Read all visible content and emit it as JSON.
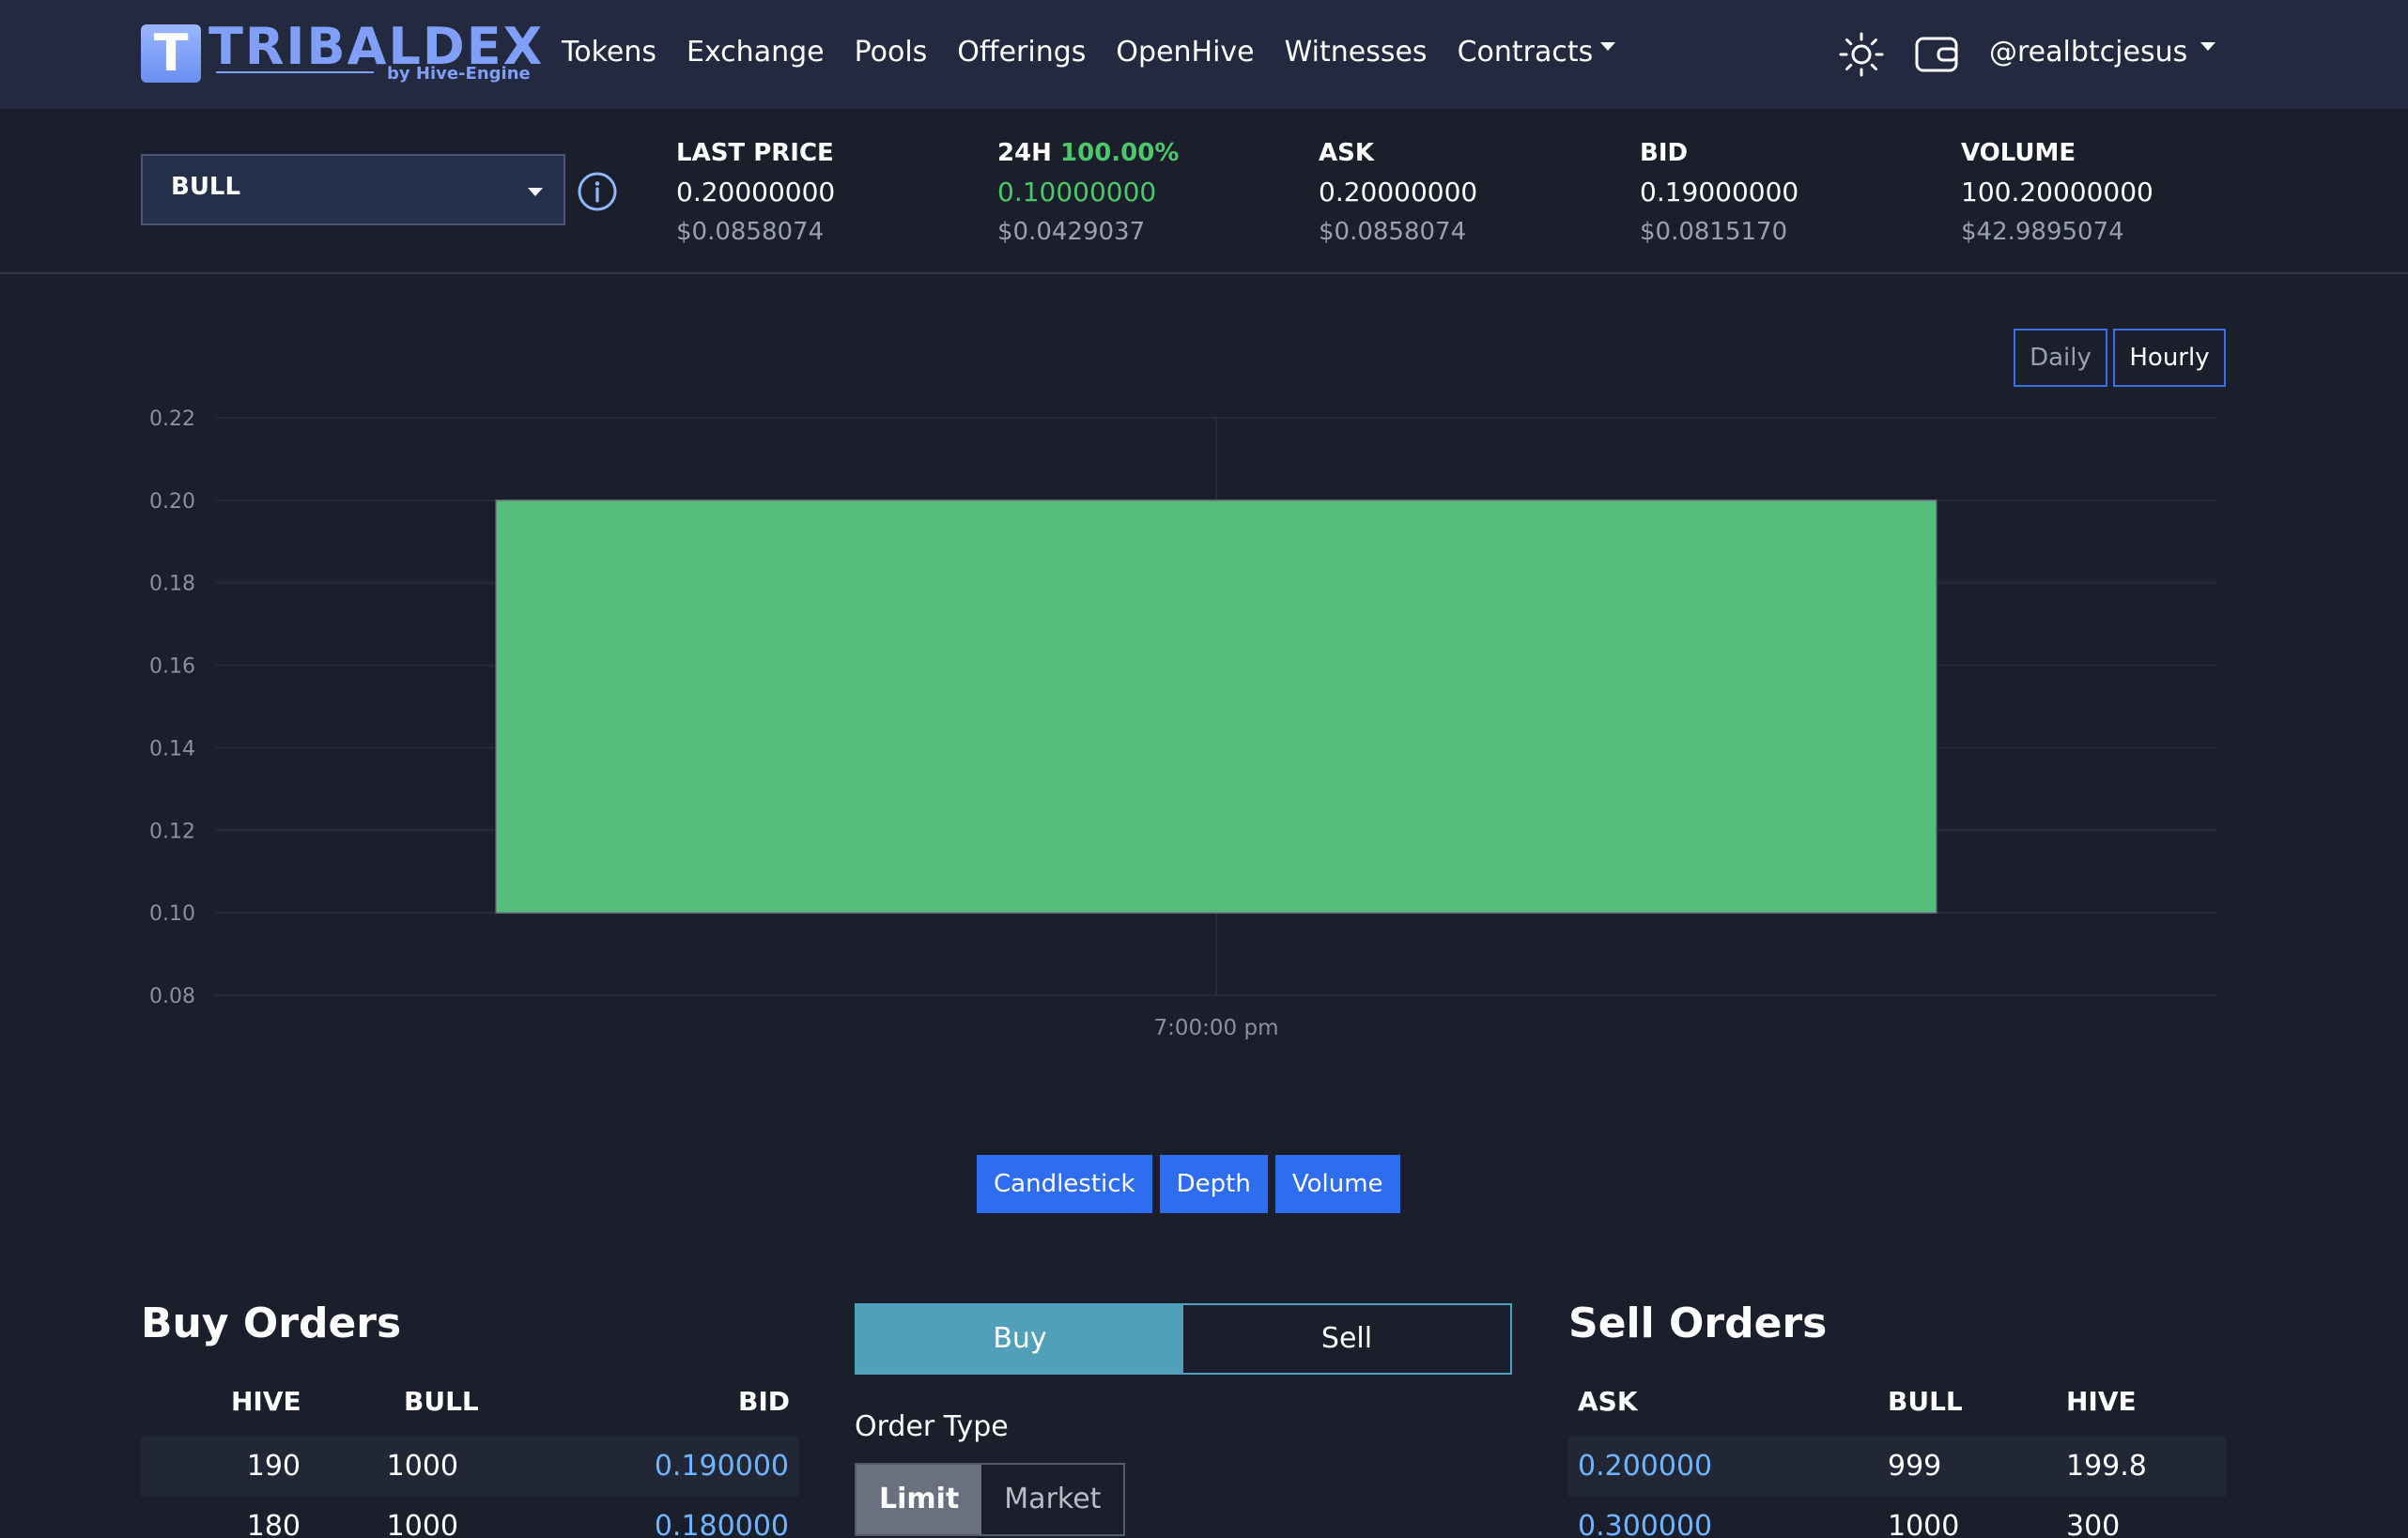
{
  "brand": {
    "mark": "T",
    "name": "TRIBALDEX",
    "sub": "by Hive-Engine"
  },
  "nav": {
    "links": [
      "Tokens",
      "Exchange",
      "Pools",
      "Offerings",
      "OpenHive",
      "Witnesses",
      "Contracts"
    ],
    "user": "@realbtcjesus"
  },
  "ticker": {
    "token": "BULL",
    "last_price": {
      "label": "LAST PRICE",
      "value": "0.20000000",
      "usd": "$0.0858074"
    },
    "change": {
      "label": "24H",
      "pct": "100.00%",
      "value": "0.10000000",
      "usd": "$0.0429037"
    },
    "ask": {
      "label": "ASK",
      "value": "0.20000000",
      "usd": "$0.0858074"
    },
    "bid": {
      "label": "BID",
      "value": "0.19000000",
      "usd": "$0.0815170"
    },
    "volume": {
      "label": "VOLUME",
      "value": "100.20000000",
      "usd": "$42.9895074"
    }
  },
  "chart_controls": {
    "ranges": [
      "Daily",
      "Hourly"
    ],
    "active_range": "Hourly",
    "types": [
      "Candlestick",
      "Depth",
      "Volume"
    ]
  },
  "chart_data": {
    "type": "candlestick",
    "x": [
      "7:00:00 pm"
    ],
    "open": [
      0.1
    ],
    "close": [
      0.2
    ],
    "high": [
      0.2
    ],
    "low": [
      0.1
    ],
    "ylim": [
      0.08,
      0.22
    ],
    "yticks": [
      "0.22",
      "0.20",
      "0.18",
      "0.16",
      "0.14",
      "0.12",
      "0.10",
      "0.08"
    ],
    "up_color": "#57bd7a",
    "grid": true
  },
  "buy_orders": {
    "title": "Buy Orders",
    "headers": [
      "HIVE",
      "BULL",
      "BID"
    ],
    "rows": [
      [
        "190",
        "1000",
        "0.190000"
      ],
      [
        "180",
        "1000",
        "0.180000"
      ]
    ]
  },
  "trade_form": {
    "tabs": [
      "Buy",
      "Sell"
    ],
    "active_tab": "Buy",
    "order_type_label": "Order Type",
    "order_types": [
      "Limit",
      "Market"
    ],
    "active_order_type": "Limit"
  },
  "sell_orders": {
    "title": "Sell Orders",
    "headers": [
      "ASK",
      "BULL",
      "HIVE"
    ],
    "rows": [
      [
        "0.200000",
        "999",
        "199.8"
      ],
      [
        "0.300000",
        "1000",
        "300"
      ]
    ]
  },
  "colors": {
    "accent": "#2f6df0",
    "positive": "#4cc86a",
    "price_link": "#6fb4ff",
    "navbar": "#232a3f"
  }
}
